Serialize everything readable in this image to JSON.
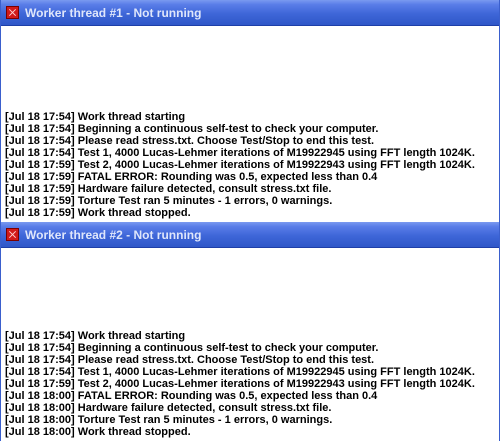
{
  "windows": [
    {
      "title": "Worker thread #1 - Not running",
      "lines": [
        "[Jul 18 17:54] Work thread starting",
        "[Jul 18 17:54] Beginning a continuous self-test to check your computer.",
        "[Jul 18 17:54] Please read stress.txt.  Choose Test/Stop to end this test.",
        "[Jul 18 17:54] Test 1, 4000 Lucas-Lehmer iterations of M19922945 using FFT length 1024K.",
        "[Jul 18 17:59] Test 2, 4000 Lucas-Lehmer iterations of M19922943 using FFT length 1024K.",
        "[Jul 18 17:59] FATAL ERROR: Rounding was 0.5, expected less than 0.4",
        "[Jul 18 17:59] Hardware failure detected, consult stress.txt file.",
        "[Jul 18 17:59] Torture Test ran 5 minutes - 1 errors, 0 warnings.",
        "[Jul 18 17:59] Work thread stopped."
      ]
    },
    {
      "title": "Worker thread #2 - Not running",
      "lines": [
        "[Jul 18 17:54] Work thread starting",
        "[Jul 18 17:54] Beginning a continuous self-test to check your computer.",
        "[Jul 18 17:54] Please read stress.txt.  Choose Test/Stop to end this test.",
        "[Jul 18 17:54] Test 1, 4000 Lucas-Lehmer iterations of M19922945 using FFT length 1024K.",
        "[Jul 18 17:59] Test 2, 4000 Lucas-Lehmer iterations of M19922943 using FFT length 1024K.",
        "[Jul 18 18:00] FATAL ERROR: Rounding was 0.5, expected less than 0.4",
        "[Jul 18 18:00] Hardware failure detected, consult stress.txt file.",
        "[Jul 18 18:00] Torture Test ran 5 minutes - 1 errors, 0 warnings.",
        "[Jul 18 18:00] Work thread stopped."
      ]
    }
  ],
  "colors": {
    "titlebar": "#3e66d8",
    "title_text": "#dfe6fb",
    "app_icon": "#d11a1a",
    "log_text": "#000000"
  },
  "icons": {
    "app": "prime95-app-icon"
  }
}
